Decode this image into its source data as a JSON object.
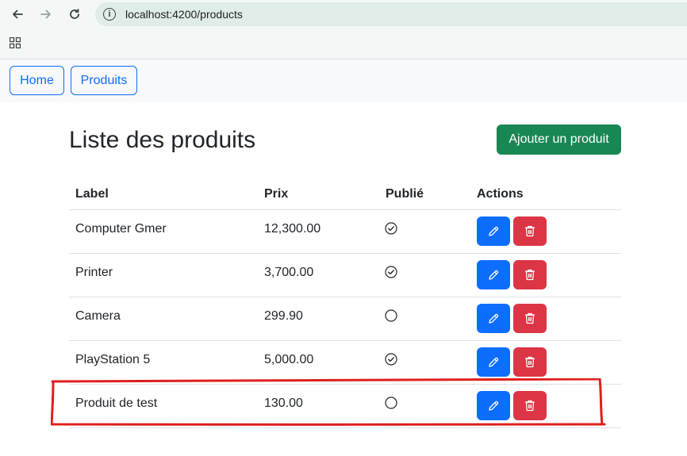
{
  "browser": {
    "url": "localhost:4200/products"
  },
  "nav": {
    "home_label": "Home",
    "products_label": "Produits"
  },
  "page": {
    "title": "Liste des produits",
    "add_button_label": "Ajouter un produit"
  },
  "table": {
    "headers": {
      "label": "Label",
      "price": "Prix",
      "published": "Publié",
      "actions": "Actions"
    },
    "rows": [
      {
        "label": "Computer Gmer",
        "price": "12,300.00",
        "published": true
      },
      {
        "label": "Printer",
        "price": "3,700.00",
        "published": true
      },
      {
        "label": "Camera",
        "price": "299.90",
        "published": false
      },
      {
        "label": "PlayStation 5",
        "price": "5,000.00",
        "published": true
      },
      {
        "label": "Produit de test",
        "price": "130.00",
        "published": false
      }
    ]
  },
  "colors": {
    "primary": "#0d6efd",
    "success": "#198754",
    "danger": "#dc3545",
    "annotation": "#e01e1e"
  },
  "icons": {
    "edit": "pencil-icon",
    "delete": "trash-icon",
    "published_true": "check-circle-icon",
    "published_false": "circle-icon"
  }
}
